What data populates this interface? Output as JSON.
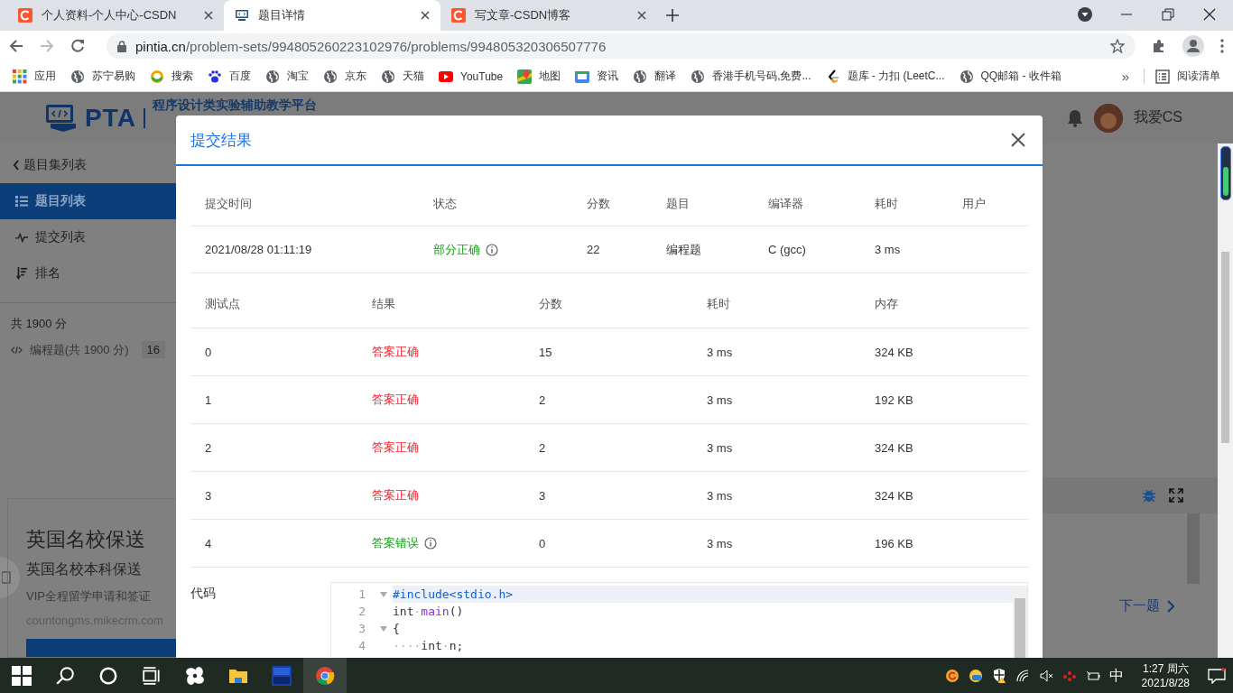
{
  "browser": {
    "tabs": [
      {
        "title": "个人资料-个人中心-CSDN",
        "kind": "csdn",
        "selected": false
      },
      {
        "title": "题目详情",
        "kind": "pta",
        "selected": true
      },
      {
        "title": "写文章-CSDN博客",
        "kind": "csdn",
        "selected": false
      }
    ],
    "address": {
      "host": "pintia.cn",
      "path": "/problem-sets/994805260223102976/problems/994805320306507776"
    },
    "bookmarks": [
      {
        "label": "应用",
        "kind": "apps"
      },
      {
        "label": "苏宁易购",
        "kind": "globe"
      },
      {
        "label": "搜索",
        "kind": "ring"
      },
      {
        "label": "百度",
        "kind": "paw"
      },
      {
        "label": "淘宝",
        "kind": "globe"
      },
      {
        "label": "京东",
        "kind": "globe"
      },
      {
        "label": "天猫",
        "kind": "globe"
      },
      {
        "label": "YouTube",
        "kind": "play"
      },
      {
        "label": "地图",
        "kind": "pin"
      },
      {
        "label": "资讯",
        "kind": "news"
      },
      {
        "label": "翻译",
        "kind": "globe"
      },
      {
        "label": "香港手机号码,免费...",
        "kind": "globe"
      },
      {
        "label": "题库 - 力扣 (LeetC...",
        "kind": "leetcode"
      },
      {
        "label": "QQ邮箱 - 收件箱",
        "kind": "globe"
      }
    ],
    "more": "»",
    "reading_list": "阅读清单"
  },
  "site": {
    "logo": "PTA",
    "subtitle": "程序设计类实验辅助教学平台",
    "user": "我爱CS",
    "sidebar": [
      {
        "label": "题目集列表",
        "kind": "back",
        "selected": false
      },
      {
        "label": "题目列表",
        "kind": "list",
        "selected": true
      },
      {
        "label": "提交列表",
        "kind": "pulse",
        "selected": false
      },
      {
        "label": "排名",
        "kind": "sort",
        "selected": false
      }
    ],
    "total": "共 1900 分",
    "category": {
      "label": "编程题(共 1900 分)",
      "count": "16"
    },
    "ad": {
      "title": "英国名校保送",
      "subtitle": "英国名校本科保送",
      "description": "VIP全程留学申请和签证",
      "domain": "countongms.mikecrm.com"
    },
    "next": "下一题"
  },
  "dialog": {
    "title": "提交结果",
    "summary": {
      "columns": [
        "提交时间",
        "状态",
        "分数",
        "题目",
        "编译器",
        "耗时",
        "用户"
      ],
      "row": {
        "time": "2021/08/28 01:11:19",
        "status": {
          "text": "部分正确",
          "color": "#18a018",
          "info": true
        },
        "score": "22",
        "problem": "编程题",
        "compiler": "C (gcc)",
        "elapsed": "3 ms"
      }
    },
    "cases": {
      "columns": [
        "测试点",
        "结果",
        "分数",
        "耗时",
        "内存"
      ],
      "rows": [
        {
          "id": "0",
          "result": "答案正确",
          "color": "#f5222d",
          "info": false,
          "score": "15",
          "time": "3 ms",
          "memory": "324 KB"
        },
        {
          "id": "1",
          "result": "答案正确",
          "color": "#f5222d",
          "info": false,
          "score": "2",
          "time": "3 ms",
          "memory": "192 KB"
        },
        {
          "id": "2",
          "result": "答案正确",
          "color": "#f5222d",
          "info": false,
          "score": "2",
          "time": "3 ms",
          "memory": "324 KB"
        },
        {
          "id": "3",
          "result": "答案正确",
          "color": "#f5222d",
          "info": false,
          "score": "3",
          "time": "3 ms",
          "memory": "324 KB"
        },
        {
          "id": "4",
          "result": "答案错误",
          "color": "#18a018",
          "info": true,
          "score": "0",
          "time": "3 ms",
          "memory": "196 KB"
        }
      ]
    },
    "code_label": "代码",
    "code": [
      {
        "number": "1",
        "fold": true,
        "selected": true,
        "tokens": [
          {
            "kind": "preproc",
            "text": "#include<stdio.h>"
          }
        ]
      },
      {
        "number": "2",
        "fold": false,
        "selected": false,
        "tokens": [
          {
            "kind": "plain",
            "text": "int"
          },
          {
            "kind": "ws",
            "text": "·"
          },
          {
            "kind": "function",
            "text": "main"
          },
          {
            "kind": "plain",
            "text": "()"
          }
        ]
      },
      {
        "number": "3",
        "fold": true,
        "selected": false,
        "tokens": [
          {
            "kind": "plain",
            "text": "{"
          }
        ]
      },
      {
        "number": "4",
        "fold": false,
        "selected": false,
        "tokens": [
          {
            "kind": "ws",
            "text": "····"
          },
          {
            "kind": "plain",
            "text": "int"
          },
          {
            "kind": "ws",
            "text": "·"
          },
          {
            "kind": "plain",
            "text": "n;"
          }
        ]
      }
    ]
  },
  "taskbar": {
    "ime": "中",
    "time": "1:27 周六",
    "date": "2021/8/28"
  }
}
